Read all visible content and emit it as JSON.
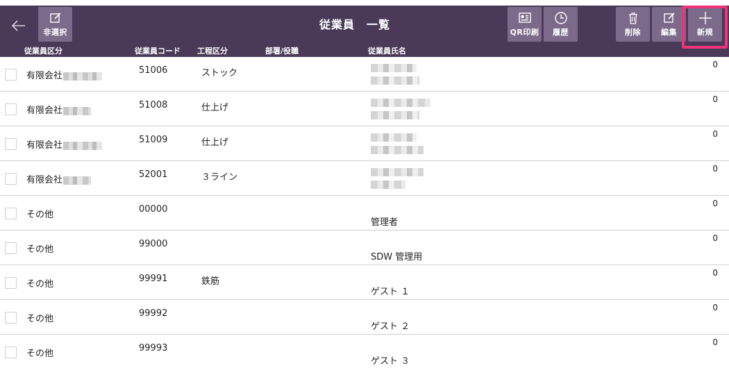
{
  "header": {
    "title": "従業員　一覧",
    "back_icon": "arrow-left-icon",
    "buttons": {
      "deselect": "非選択",
      "qr_print": "QR印刷",
      "history": "履歴",
      "delete": "削除",
      "edit": "編集",
      "new": "新規"
    }
  },
  "columns": {
    "kubun": "従業員区分",
    "code": "従業員コード",
    "koutei": "工程区分",
    "busho": "部署/役職",
    "name": "従業員氏名"
  },
  "rows": [
    {
      "kubun": "有限会社",
      "code": "51006",
      "koutei": "ストック",
      "name": "",
      "num": "0"
    },
    {
      "kubun": "有限会社",
      "code": "51008",
      "koutei": "仕上げ",
      "name": "",
      "num": "0"
    },
    {
      "kubun": "有限会社",
      "code": "51009",
      "koutei": "仕上げ",
      "name": "",
      "num": "0"
    },
    {
      "kubun": "有限会社",
      "code": "52001",
      "koutei": "３ライン",
      "name": "",
      "num": "0"
    },
    {
      "kubun": "その他",
      "code": "00000",
      "koutei": "",
      "name": "管理者",
      "num": "0"
    },
    {
      "kubun": "その他",
      "code": "99000",
      "koutei": "",
      "name": "SDW 管理用",
      "num": "0"
    },
    {
      "kubun": "その他",
      "code": "99991",
      "koutei": "鉄筋",
      "name": "ゲスト １",
      "num": "0"
    },
    {
      "kubun": "その他",
      "code": "99992",
      "koutei": "",
      "name": "ゲスト ２",
      "num": "0"
    },
    {
      "kubun": "その他",
      "code": "99993",
      "koutei": "",
      "name": "ゲスト ３",
      "num": "0"
    }
  ],
  "colors": {
    "header_bg": "#4a3a57",
    "button_bg": "#7c6a8a",
    "highlight": "#ee3377"
  }
}
